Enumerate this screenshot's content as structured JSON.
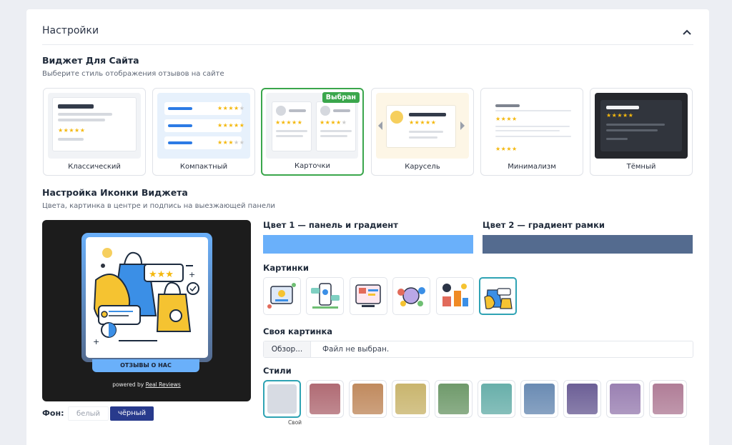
{
  "header": {
    "title": "Настройки"
  },
  "widget": {
    "title": "Виджет Для Сайта",
    "subtitle": "Выберите стиль отображения отзывов на сайте",
    "selected_badge": "Выбран",
    "styles": [
      {
        "label": "Классический"
      },
      {
        "label": "Компактный"
      },
      {
        "label": "Карточки",
        "selected": true
      },
      {
        "label": "Карусель"
      },
      {
        "label": "Минимализм"
      },
      {
        "label": "Тёмный"
      }
    ]
  },
  "icon": {
    "title": "Настройка Иконки Виджета",
    "subtitle": "Цвета, картинка в центре и подпись на выезжающей панели",
    "panel_caption": "ОТЗЫВЫ О НАС",
    "powered_prefix": "powered by",
    "powered_brand": "Real Reviews",
    "background": {
      "label": "Фон:",
      "white": "белый",
      "black": "чёрный",
      "selected": "чёрный"
    }
  },
  "colors": {
    "color1_label": "Цвет 1 — панель и градиент",
    "color1": "#6ab0fa",
    "color2_label": "Цвет 2 — градиент рамки",
    "color2": "#546b8f"
  },
  "pictures": {
    "title": "Картинки",
    "count": 6,
    "selected_index": 5
  },
  "custom_picture": {
    "title": "Своя картинка",
    "browse_label": "Обзор...",
    "status": "Файл не выбран."
  },
  "styles_section": {
    "title": "Стили",
    "custom_caption": "Свой",
    "swatches": [
      "#d7dbe3",
      "#b06b74",
      "#c08a5e",
      "#c9b56e",
      "#6f9a6b",
      "#68afaa",
      "#6a8bb3",
      "#6c5f96",
      "#9a80b2",
      "#b07d97"
    ]
  }
}
